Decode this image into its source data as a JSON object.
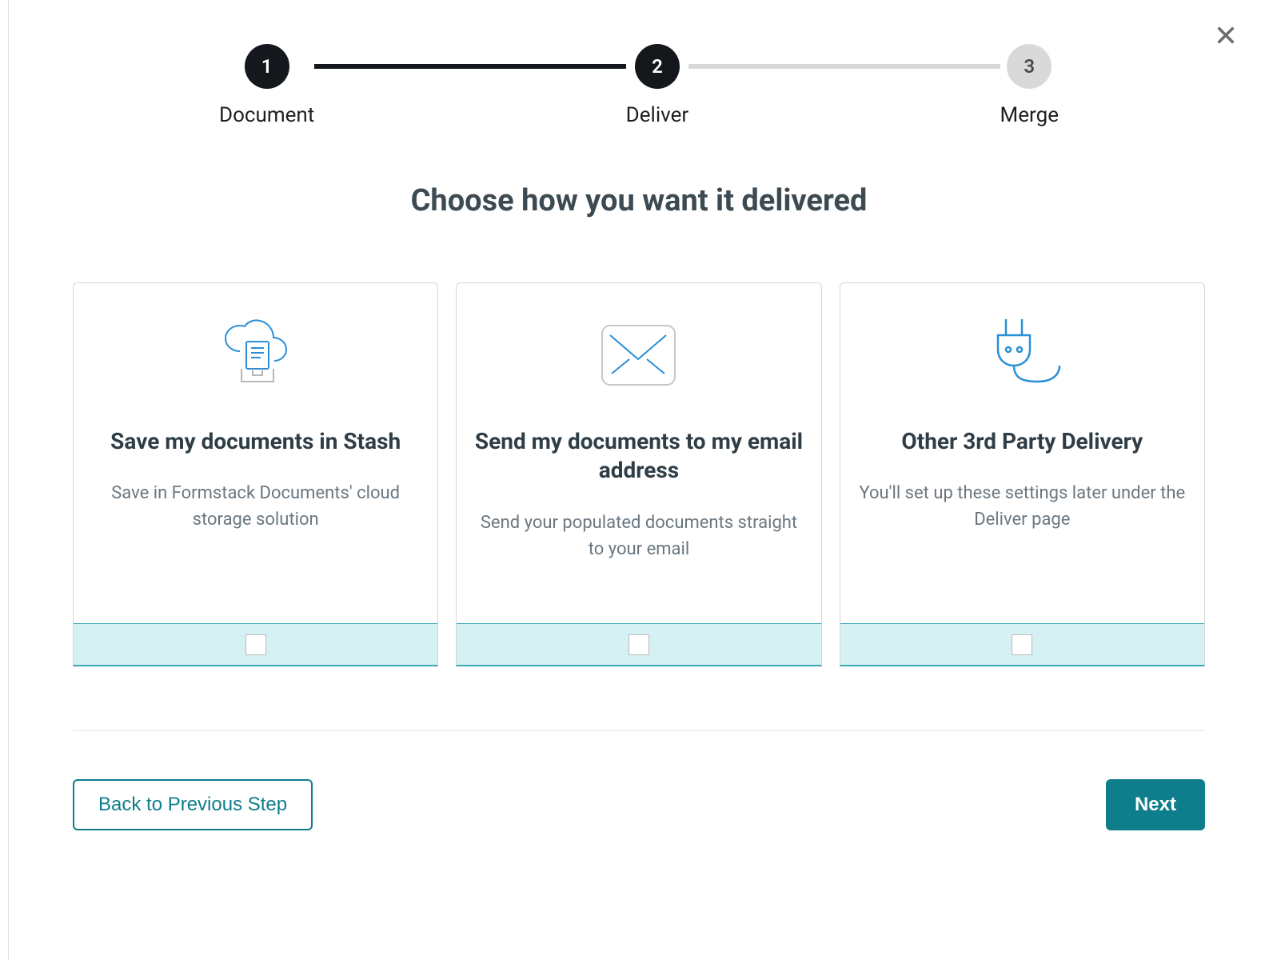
{
  "stepper": {
    "steps": [
      {
        "num": "1",
        "label": "Document",
        "state": "done"
      },
      {
        "num": "2",
        "label": "Deliver",
        "state": "active"
      },
      {
        "num": "3",
        "label": "Merge",
        "state": "pending"
      }
    ]
  },
  "title": "Choose how you want it delivered",
  "cards": [
    {
      "title": "Save my documents in Stash",
      "desc": "Save in Formstack Documents' cloud storage solution"
    },
    {
      "title": "Send my documents to my email address",
      "desc": "Send your populated documents straight to your email"
    },
    {
      "title": "Other 3rd Party Delivery",
      "desc": "You'll set up these settings later under the Deliver page"
    }
  ],
  "footer": {
    "back": "Back to Previous Step",
    "next": "Next"
  }
}
